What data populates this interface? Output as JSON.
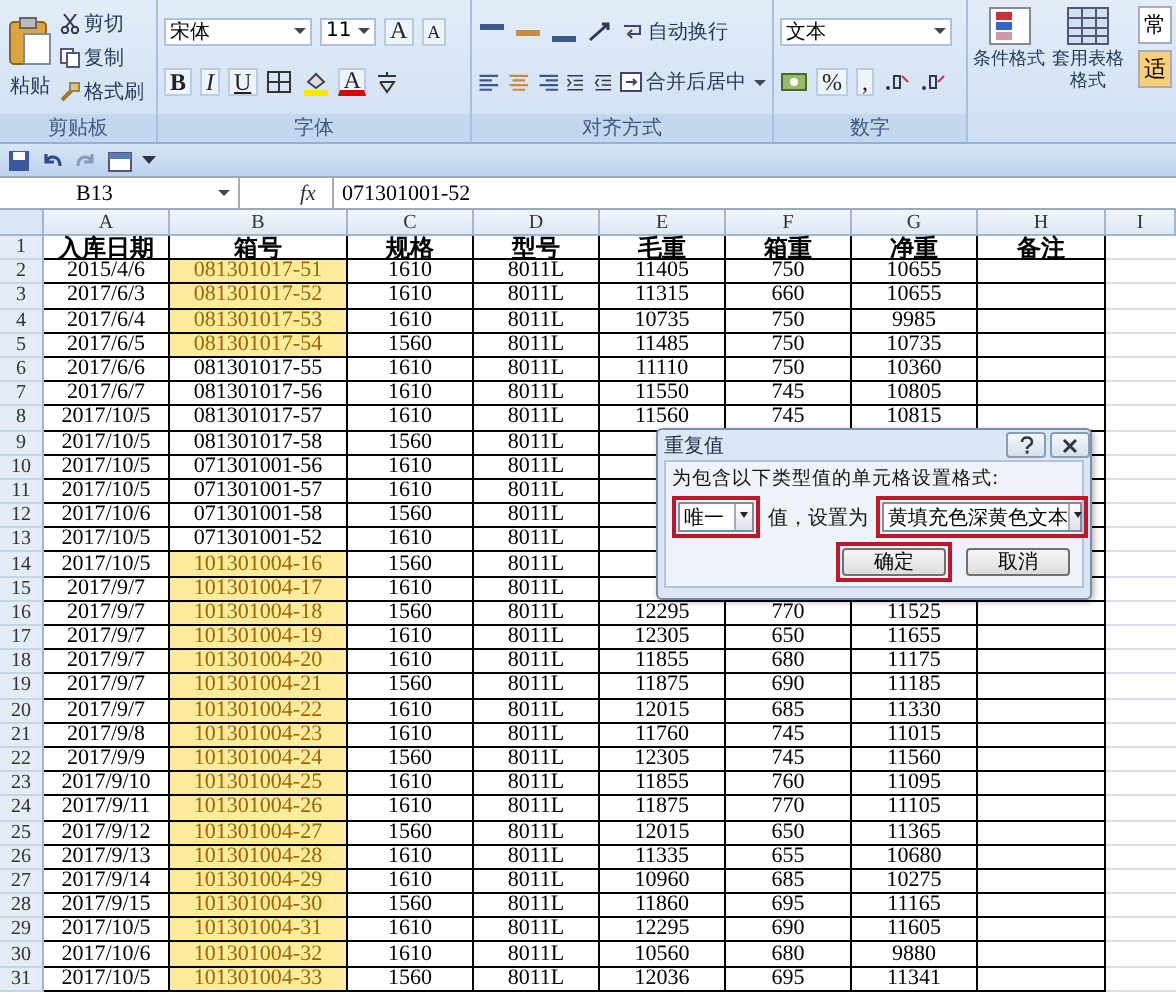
{
  "ribbon": {
    "clipboard": {
      "label": "剪贴板",
      "paste": "粘贴",
      "items": [
        "剪切",
        "复制",
        "格式刷"
      ]
    },
    "font": {
      "label": "字体",
      "font": "宋体",
      "size": "11",
      "grow": "A",
      "shrink": "A",
      "styles": [
        "B",
        "I",
        "U"
      ],
      "color_letter": "A"
    },
    "alignment": {
      "label": "对齐方式",
      "wrap": "自动换行",
      "merge": "合并后居中"
    },
    "number": {
      "label": "数字",
      "format": "文本",
      "percent": "%",
      "comma": ","
    },
    "styles": {
      "conditional": "条件格式",
      "table": "套用表格格式",
      "cell_styles": [
        "常",
        "适"
      ]
    }
  },
  "formula_bar": {
    "name_box": "B13",
    "fx": "fx",
    "value": "071301001-52"
  },
  "sheet": {
    "columns": [
      "A",
      "B",
      "C",
      "D",
      "E",
      "F",
      "G",
      "H",
      "I"
    ],
    "header_row": {
      "num": "1",
      "cells": [
        "入库日期",
        "箱号",
        "规格",
        "型号",
        "毛重",
        "箱重",
        "净重",
        "备注"
      ]
    },
    "rows": [
      {
        "num": "2",
        "highlighted": true,
        "cells": [
          "2015/4/6",
          "081301017-51",
          "1610",
          "8011L",
          "11405",
          "750",
          "10655"
        ]
      },
      {
        "num": "3",
        "highlighted": true,
        "cells": [
          "2017/6/3",
          "081301017-52",
          "1610",
          "8011L",
          "11315",
          "660",
          "10655"
        ]
      },
      {
        "num": "4",
        "highlighted": true,
        "cells": [
          "2017/6/4",
          "081301017-53",
          "1610",
          "8011L",
          "10735",
          "750",
          "9985"
        ]
      },
      {
        "num": "5",
        "highlighted": true,
        "cells": [
          "2017/6/5",
          "081301017-54",
          "1560",
          "8011L",
          "11485",
          "750",
          "10735"
        ]
      },
      {
        "num": "6",
        "highlighted": false,
        "cells": [
          "2017/6/6",
          "081301017-55",
          "1610",
          "8011L",
          "11110",
          "750",
          "10360"
        ]
      },
      {
        "num": "7",
        "highlighted": false,
        "cells": [
          "2017/6/7",
          "081301017-56",
          "1610",
          "8011L",
          "11550",
          "745",
          "10805"
        ]
      },
      {
        "num": "8",
        "highlighted": false,
        "cells": [
          "2017/10/5",
          "081301017-57",
          "1610",
          "8011L",
          "11560",
          "745",
          "10815"
        ]
      },
      {
        "num": "9",
        "highlighted": false,
        "cells": [
          "2017/10/5",
          "081301017-58",
          "1560",
          "8011L",
          null,
          null,
          null
        ]
      },
      {
        "num": "10",
        "highlighted": false,
        "cells": [
          "2017/10/5",
          "071301001-56",
          "1610",
          "8011L",
          null,
          null,
          null
        ]
      },
      {
        "num": "11",
        "highlighted": false,
        "cells": [
          "2017/10/5",
          "071301001-57",
          "1610",
          "8011L",
          null,
          null,
          null
        ]
      },
      {
        "num": "12",
        "highlighted": false,
        "cells": [
          "2017/10/6",
          "071301001-58",
          "1560",
          "8011L",
          null,
          null,
          null
        ]
      },
      {
        "num": "13",
        "highlighted": false,
        "cells": [
          "2017/10/5",
          "071301001-52",
          "1610",
          "8011L",
          null,
          null,
          null
        ]
      },
      {
        "num": "14",
        "highlighted": true,
        "cells": [
          "2017/10/5",
          "101301004-16",
          "1560",
          "8011L",
          null,
          null,
          null
        ]
      },
      {
        "num": "15",
        "highlighted": true,
        "cells": [
          "2017/9/7",
          "101301004-17",
          "1610",
          "8011L",
          null,
          null,
          null
        ]
      },
      {
        "num": "16",
        "highlighted": true,
        "cells": [
          "2017/9/7",
          "101301004-18",
          "1560",
          "8011L",
          "12295",
          "770",
          "11525"
        ]
      },
      {
        "num": "17",
        "highlighted": true,
        "cells": [
          "2017/9/7",
          "101301004-19",
          "1610",
          "8011L",
          "12305",
          "650",
          "11655"
        ]
      },
      {
        "num": "18",
        "highlighted": true,
        "cells": [
          "2017/9/7",
          "101301004-20",
          "1610",
          "8011L",
          "11855",
          "680",
          "11175"
        ]
      },
      {
        "num": "19",
        "highlighted": true,
        "cells": [
          "2017/9/7",
          "101301004-21",
          "1560",
          "8011L",
          "11875",
          "690",
          "11185"
        ]
      },
      {
        "num": "20",
        "highlighted": true,
        "cells": [
          "2017/9/7",
          "101301004-22",
          "1610",
          "8011L",
          "12015",
          "685",
          "11330"
        ]
      },
      {
        "num": "21",
        "highlighted": true,
        "cells": [
          "2017/9/8",
          "101301004-23",
          "1610",
          "8011L",
          "11760",
          "745",
          "11015"
        ]
      },
      {
        "num": "22",
        "highlighted": true,
        "cells": [
          "2017/9/9",
          "101301004-24",
          "1560",
          "8011L",
          "12305",
          "745",
          "11560"
        ]
      },
      {
        "num": "23",
        "highlighted": true,
        "cells": [
          "2017/9/10",
          "101301004-25",
          "1610",
          "8011L",
          "11855",
          "760",
          "11095"
        ]
      },
      {
        "num": "24",
        "highlighted": true,
        "cells": [
          "2017/9/11",
          "101301004-26",
          "1610",
          "8011L",
          "11875",
          "770",
          "11105"
        ]
      },
      {
        "num": "25",
        "highlighted": true,
        "cells": [
          "2017/9/12",
          "101301004-27",
          "1560",
          "8011L",
          "12015",
          "650",
          "11365"
        ]
      },
      {
        "num": "26",
        "highlighted": true,
        "cells": [
          "2017/9/13",
          "101301004-28",
          "1610",
          "8011L",
          "11335",
          "655",
          "10680"
        ]
      },
      {
        "num": "27",
        "highlighted": true,
        "cells": [
          "2017/9/14",
          "101301004-29",
          "1610",
          "8011L",
          "10960",
          "685",
          "10275"
        ]
      },
      {
        "num": "28",
        "highlighted": true,
        "cells": [
          "2017/9/15",
          "101301004-30",
          "1560",
          "8011L",
          "11860",
          "695",
          "11165"
        ]
      },
      {
        "num": "29",
        "highlighted": true,
        "cells": [
          "2017/10/5",
          "101301004-31",
          "1610",
          "8011L",
          "12295",
          "690",
          "11605"
        ]
      },
      {
        "num": "30",
        "highlighted": true,
        "cells": [
          "2017/10/6",
          "101301004-32",
          "1610",
          "8011L",
          "10560",
          "680",
          "9880"
        ]
      },
      {
        "num": "31",
        "highlighted": true,
        "cells": [
          "2017/10/5",
          "101301004-33",
          "1560",
          "8011L",
          "12036",
          "695",
          "11341"
        ]
      }
    ]
  },
  "dialog": {
    "title": "重复值",
    "prompt": "为包含以下类型值的单元格设置格式:",
    "rule_select": {
      "value": "唯一",
      "annotated": true
    },
    "middle_text": "值，设置为",
    "format_select": {
      "value": "黄填充色深黄色文本",
      "annotated": true
    },
    "buttons": [
      {
        "label": "确定",
        "annotated": true
      },
      {
        "label": "取消",
        "annotated": false
      }
    ]
  }
}
